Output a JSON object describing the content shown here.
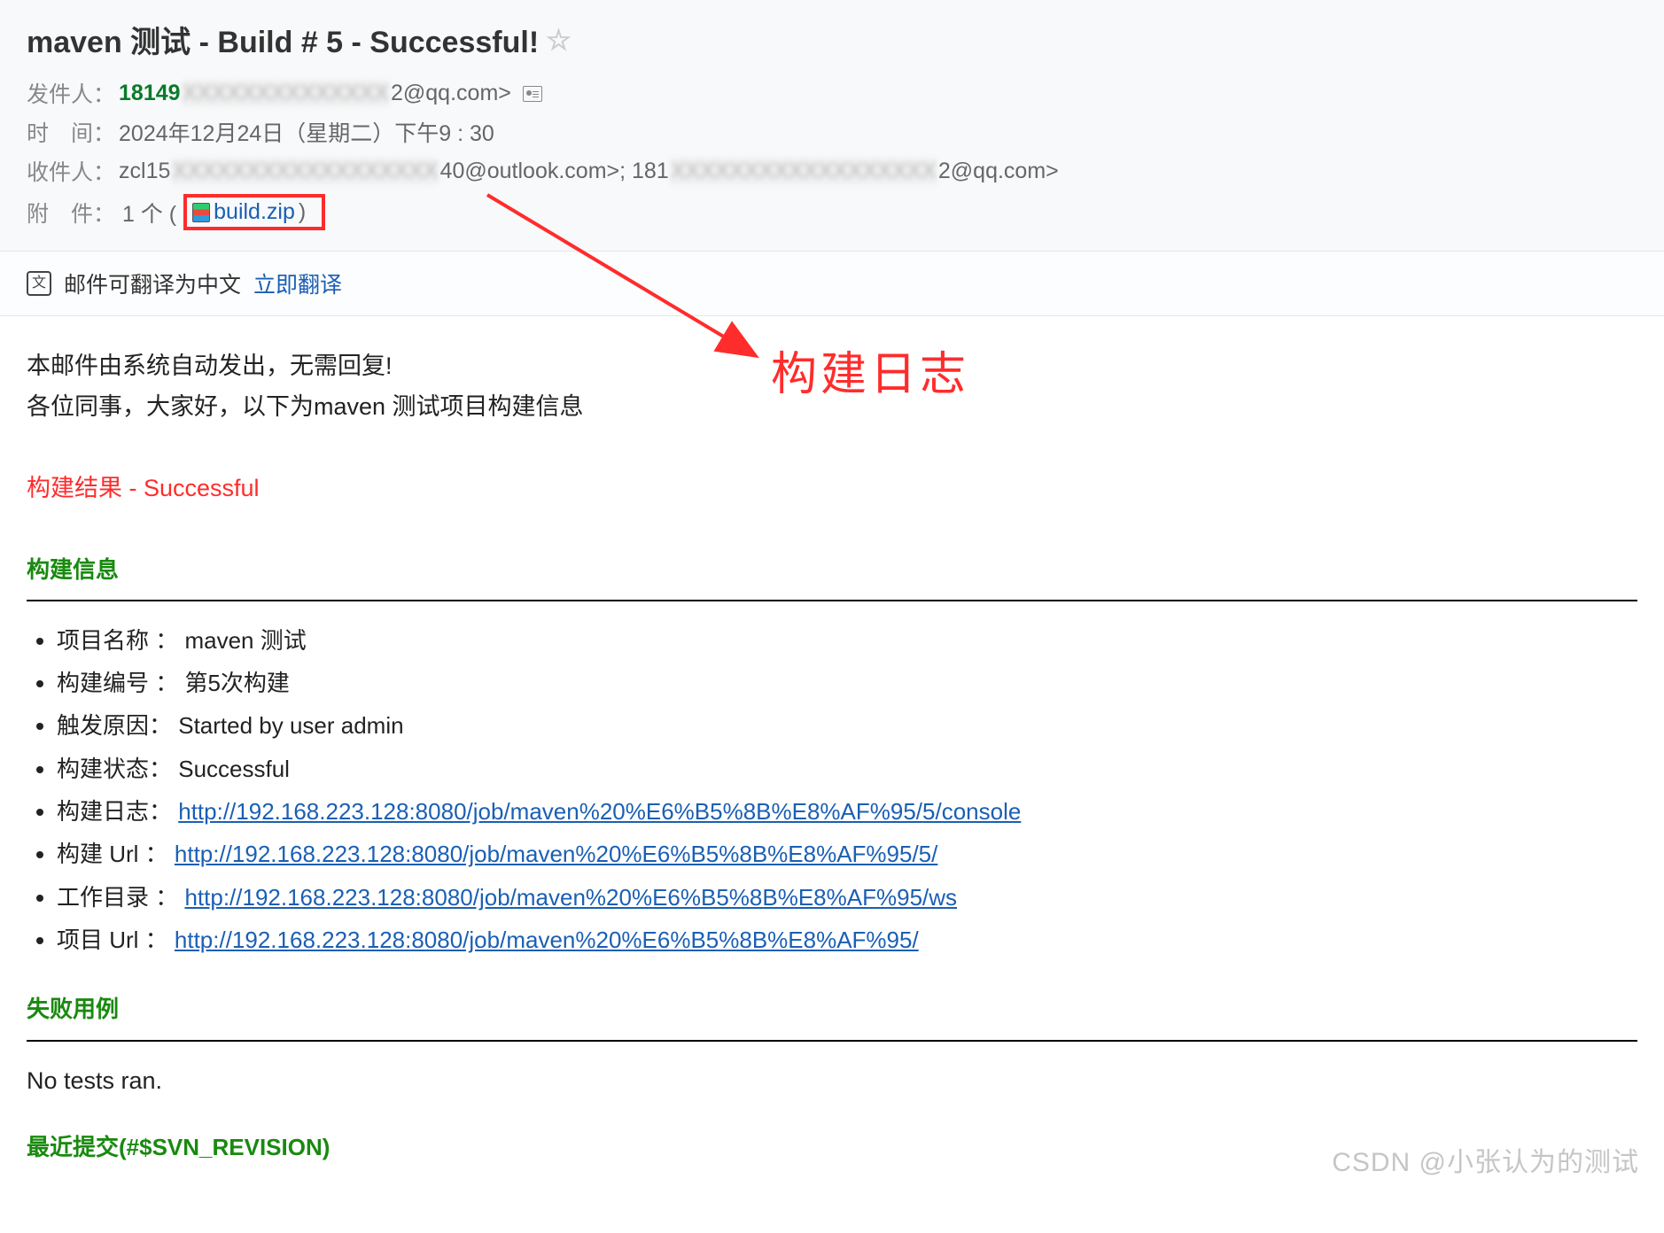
{
  "header": {
    "subject": "maven 测试 - Build # 5 - Successful!",
    "sender_label": "发件人：",
    "sender_prefix": "18149",
    "sender_blur": "XXXXXXXXXXXXXX",
    "sender_suffix": "2@qq.com>",
    "time_label": "时　间：",
    "time_value": "2024年12月24日（星期二）下午9 : 30",
    "recipient_label": "收件人：",
    "recipient_part1": "zcl15",
    "recipient_blur1": "XXXXXXXXXXXXXXXXXX",
    "recipient_part2": "40@outlook.com>;  181",
    "recipient_blur2": "XXXXXXXXXXXXXXXXXX",
    "recipient_part3": "2@qq.com>",
    "attachment_label": "附　件：",
    "attachment_count": "1 个 (",
    "attachment_name": "build.zip",
    "attachment_close": ")"
  },
  "translate": {
    "text": "邮件可翻译为中文",
    "link": "立即翻译"
  },
  "annotation_text": "构建日志",
  "body": {
    "auto_line": "本邮件由系统自动发出，无需回复!",
    "greeting": "各位同事，大家好，以下为maven 测试项目构建信息",
    "result_line": "构建结果 - Successful",
    "build_info_title": "构建信息",
    "items": [
      {
        "label": "项目名称 ：  maven 测试"
      },
      {
        "label": "构建编号 ：  第5次构建"
      },
      {
        "label": "触发原因：  Started by user admin"
      },
      {
        "label": "构建状态：  Successful"
      },
      {
        "label": "构建日志：  ",
        "link": "http://192.168.223.128:8080/job/maven%20%E6%B5%8B%E8%AF%95/5/console"
      },
      {
        "label": "构建 Url ：  ",
        "link": "http://192.168.223.128:8080/job/maven%20%E6%B5%8B%E8%AF%95/5/"
      },
      {
        "label": "工作目录 ：   ",
        "link": "http://192.168.223.128:8080/job/maven%20%E6%B5%8B%E8%AF%95/ws"
      },
      {
        "label": "项目 Url ：  ",
        "link": "http://192.168.223.128:8080/job/maven%20%E6%B5%8B%E8%AF%95/"
      }
    ],
    "fail_title": "失败用例",
    "no_tests": "No tests ran.",
    "svn_line": "最近提交(#$SVN_REVISION)"
  },
  "watermark": "CSDN @小张认为的测试"
}
